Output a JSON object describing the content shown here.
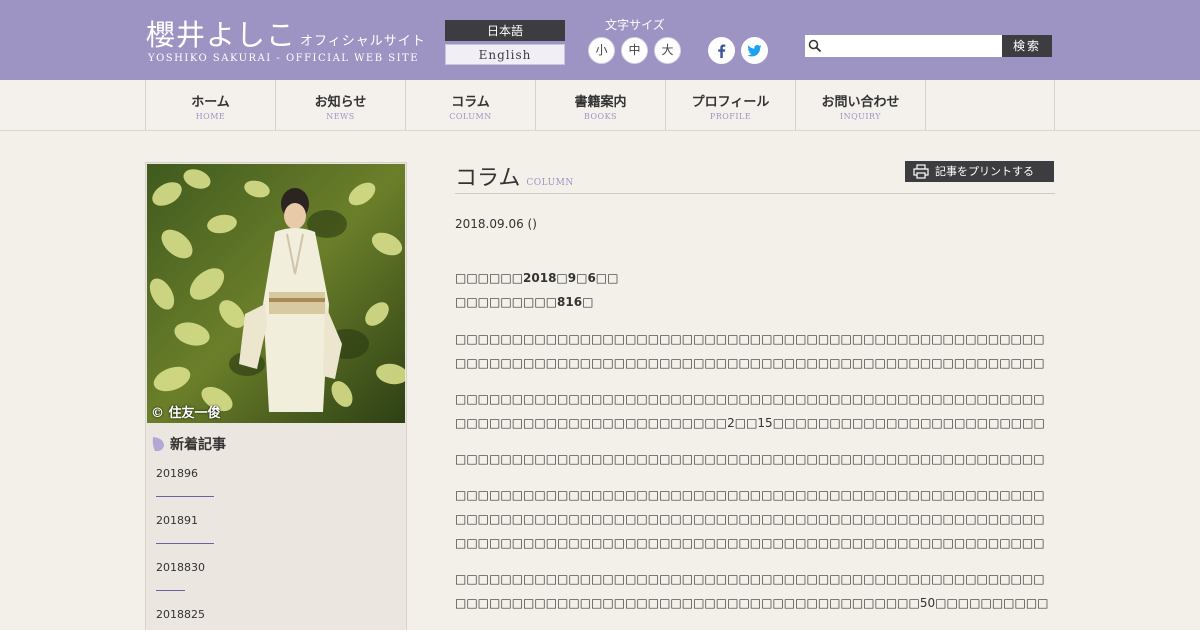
{
  "header": {
    "logo_main": "櫻井よしこ",
    "logo_suffix": "オフィシャルサイト",
    "logo_sub": "YOSHIKO SAKURAI - OFFICIAL WEB SITE",
    "lang_ja": "日本語",
    "lang_en": "English",
    "font_size_label": "文字サイズ",
    "font_sizes": [
      "小",
      "中",
      "大"
    ],
    "search_placeholder": "",
    "search_button": "検索",
    "bg_color": "#9e94c3"
  },
  "nav": {
    "items": [
      {
        "jp": "ホーム",
        "en": "HOME"
      },
      {
        "jp": "お知らせ",
        "en": "NEWS"
      },
      {
        "jp": "コラム",
        "en": "COLUMN"
      },
      {
        "jp": "書籍案内",
        "en": "BOOKS"
      },
      {
        "jp": "プロフィール",
        "en": "PROFILE"
      },
      {
        "jp": "お問い合わせ",
        "en": "INQUIRY"
      }
    ]
  },
  "sidebar": {
    "photo_credit": "© 住友一俊",
    "heading": "新着記事",
    "news": [
      "201896",
      "201891",
      "2018830",
      "2018825"
    ]
  },
  "main": {
    "title": "コラム",
    "title_en": "COLUMN",
    "print_button": "記事をプリントする",
    "date": "2018.09.06 ()",
    "meta_line1": "2018\u0000\u00009\u00006\u0000\u0000",
    "meta_line2": "816",
    "paragraphs": [
      "p1",
      "p2",
      "p3",
      "p4",
      "p5"
    ]
  }
}
